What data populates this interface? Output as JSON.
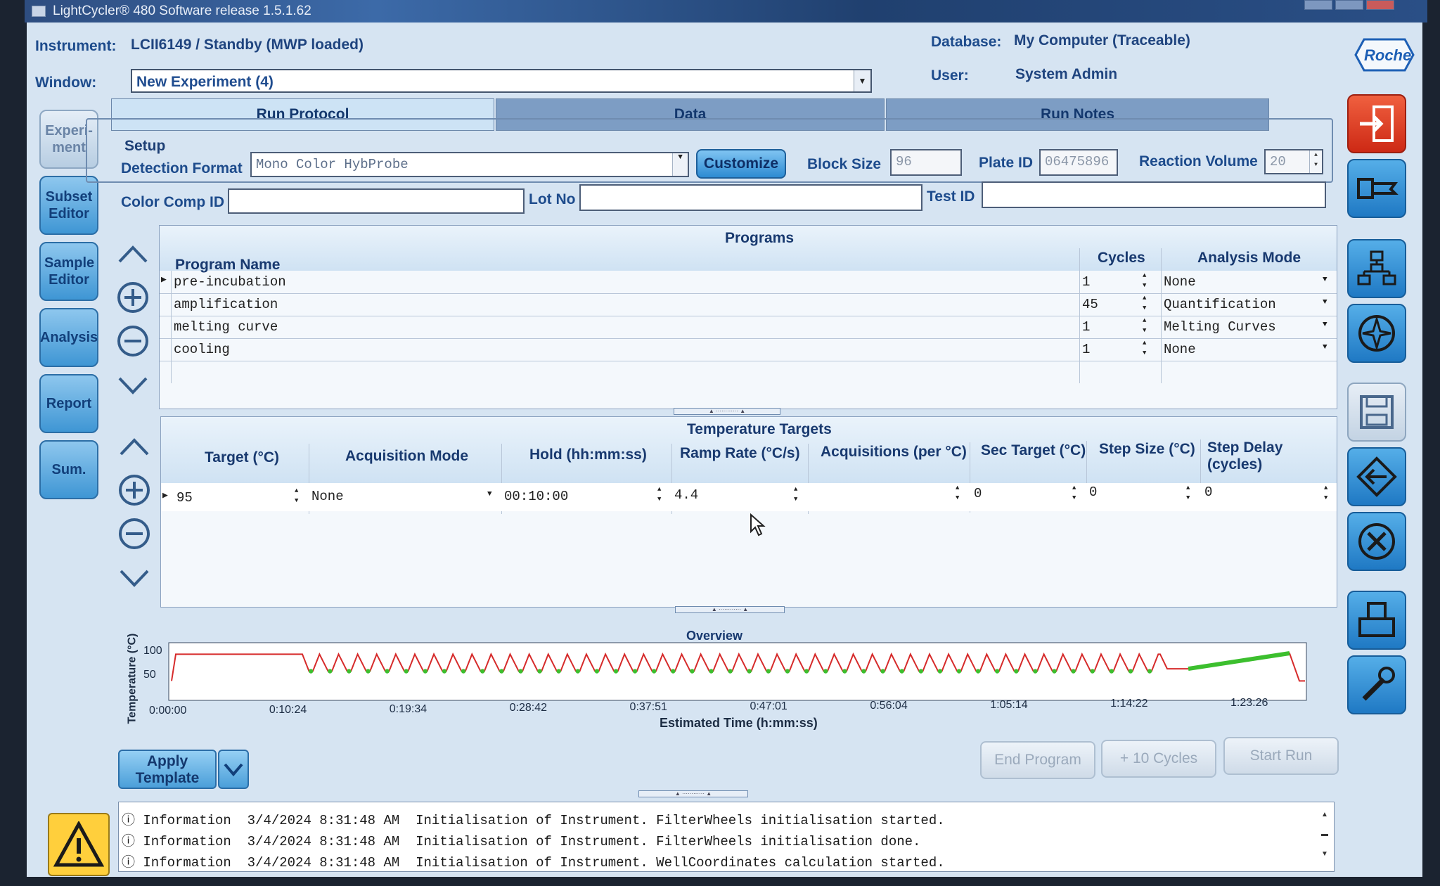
{
  "title_bar": {
    "text": "LightCycler® 480 Software release 1.5.1.62"
  },
  "header": {
    "instrument_label": "Instrument:",
    "instrument_value": "LCII6149 / Standby (MWP loaded)",
    "window_label": "Window:",
    "window_value": "New Experiment (4)",
    "database_label": "Database:",
    "database_value": "My Computer (Traceable)",
    "user_label": "User:",
    "user_value": "System Admin",
    "logo": "Roche"
  },
  "left_nav": [
    {
      "label": "Experi- ment",
      "active": false
    },
    {
      "label": "Subset Editor",
      "active": true
    },
    {
      "label": "Sample Editor",
      "active": true
    },
    {
      "label": "Analysis",
      "active": true
    },
    {
      "label": "Report",
      "active": true
    },
    {
      "label": "Sum.",
      "active": true
    }
  ],
  "tabs": [
    {
      "label": "Run Protocol",
      "active": true
    },
    {
      "label": "Data",
      "active": false
    },
    {
      "label": "Run Notes",
      "active": false
    }
  ],
  "setup": {
    "legend": "Setup",
    "detection_format_label": "Detection Format",
    "detection_format_value": "Mono Color HybProbe",
    "customize_label": "Customize",
    "block_size_label": "Block Size",
    "block_size_value": "96",
    "plate_id_label": "Plate ID",
    "plate_id_value": "06475896",
    "reaction_volume_label": "Reaction Volume",
    "reaction_volume_value": "20",
    "color_comp_label": "Color Comp ID",
    "color_comp_value": "",
    "lot_no_label": "Lot No",
    "lot_no_value": "",
    "test_id_label": "Test ID",
    "test_id_value": ""
  },
  "programs": {
    "title": "Programs",
    "columns": {
      "name": "Program Name",
      "cycles": "Cycles",
      "mode": "Analysis Mode"
    },
    "rows": [
      {
        "name": "pre-incubation",
        "cycles": "1",
        "mode": "None"
      },
      {
        "name": "amplification",
        "cycles": "45",
        "mode": "Quantification"
      },
      {
        "name": "melting curve",
        "cycles": "1",
        "mode": "Melting Curves"
      },
      {
        "name": "cooling",
        "cycles": "1",
        "mode": "None"
      }
    ]
  },
  "targets": {
    "title": "Temperature Targets",
    "columns": {
      "target": "Target (°C)",
      "acq_mode": "Acquisition Mode",
      "hold": "Hold (hh:mm:ss)",
      "ramp": "Ramp Rate (°C/s)",
      "acq_per": "Acquisitions (per °C)",
      "sec_target": "Sec Target (°C)",
      "step_size": "Step Size (°C)",
      "step_delay": "Step Delay (cycles)"
    },
    "row": {
      "target": "95",
      "acq_mode": "None",
      "hold": "00:10:00",
      "ramp": "4.4",
      "acq_per": "",
      "sec_target": "0",
      "step_size": "0",
      "step_delay": "0"
    }
  },
  "overview": {
    "title": "Overview",
    "ylabel": "Temperature (°C)",
    "xlabel": "Estimated Time (h:mm:ss)",
    "yticks": [
      "100",
      "50"
    ],
    "xticks": [
      "0:00:00",
      "0:10:24",
      "0:19:34",
      "0:28:42",
      "0:37:51",
      "0:47:01",
      "0:56:04",
      "1:05:14",
      "1:14:22",
      "1:23:26"
    ],
    "profile_color": "#d62b2b",
    "acquisition_color": "#3cbf2e"
  },
  "chart_data": {
    "type": "line",
    "title": "Overview",
    "xlabel": "Estimated Time (h:mm:ss)",
    "ylabel": "Temperature (°C)",
    "ylim": [
      0,
      110
    ],
    "xticks": [
      "0:00:00",
      "0:10:24",
      "0:19:34",
      "0:28:42",
      "0:37:51",
      "0:47:01",
      "0:56:04",
      "1:05:14",
      "1:14:22",
      "1:23:26"
    ],
    "series": [
      {
        "values": {
          "pre_incubation": {
            "temp": 95,
            "duration_min": 10
          },
          "amplification": {
            "cycles": 45,
            "high": 95,
            "low": 60
          },
          "melting": {
            "start": 65,
            "end": 97
          },
          "cooling": {
            "temp": 40
          }
        }
      }
    ],
    "grid": false,
    "legend": "none"
  },
  "buttons": {
    "apply_template": "Apply Template",
    "end_program": "End Program",
    "plus_cycles": "+ 10 Cycles",
    "start_run": "Start Run"
  },
  "log": [
    {
      "type": "Information",
      "date": "3/4/2024",
      "time": "8:31:48 AM",
      "message": "Initialisation of Instrument. FilterWheels initialisation started."
    },
    {
      "type": "Information",
      "date": "3/4/2024",
      "time": "8:31:48 AM",
      "message": "Initialisation of Instrument. FilterWheels initialisation done."
    },
    {
      "type": "Information",
      "date": "3/4/2024",
      "time": "8:31:48 AM",
      "message": "Initialisation of Instrument. WellCoordinates calculation started."
    }
  ]
}
